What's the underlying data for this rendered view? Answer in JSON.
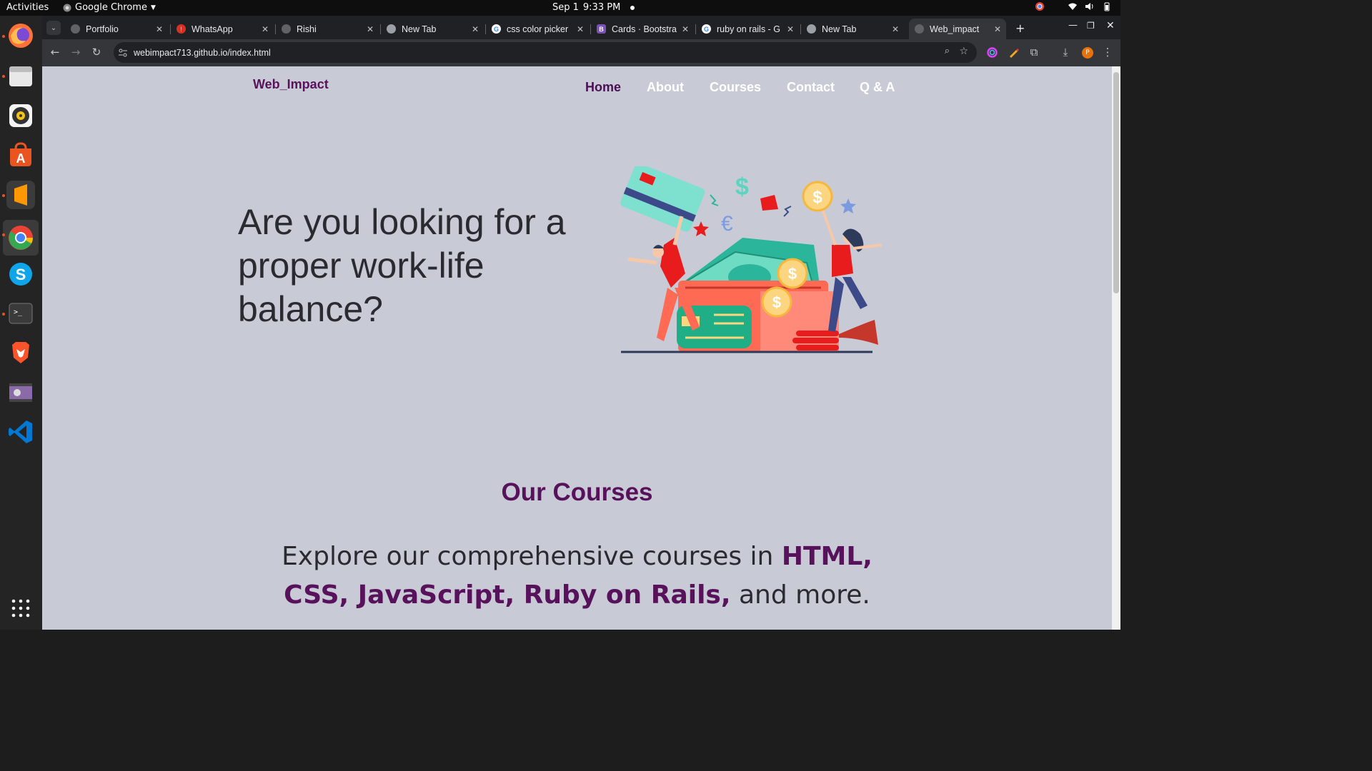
{
  "topbar": {
    "activities": "Activities",
    "app_name": "Google Chrome",
    "date": "Sep 1",
    "time": "9:33 PM"
  },
  "dock": {
    "apps": [
      "firefox-icon",
      "files-icon",
      "rhythmbox-icon",
      "app-center-icon",
      "sublime-text-icon",
      "chrome-icon",
      "skype-icon",
      "terminal-icon",
      "brave-icon",
      "video-icon",
      "vscode-icon",
      "app-grid-icon"
    ]
  },
  "browser": {
    "tabs": [
      {
        "title": "Portfolio",
        "favicon": "globe-icon"
      },
      {
        "title": "WhatsApp",
        "favicon": "whatsapp-icon"
      },
      {
        "title": "Rishi",
        "favicon": "globe-icon"
      },
      {
        "title": "New Tab",
        "favicon": "chrome-icon"
      },
      {
        "title": "css color picker",
        "favicon": "google-icon"
      },
      {
        "title": "Cards · Bootstra",
        "favicon": "bootstrap-icon"
      },
      {
        "title": "ruby on rails - G",
        "favicon": "google-icon"
      },
      {
        "title": "New Tab",
        "favicon": "chrome-icon"
      },
      {
        "title": "Web_impact",
        "favicon": "globe-icon",
        "active": true
      }
    ],
    "url": "webimpact713.github.io/index.html"
  },
  "site": {
    "brand": "Web_Impact",
    "nav": [
      {
        "label": "Home",
        "active": true
      },
      {
        "label": "About"
      },
      {
        "label": "Courses"
      },
      {
        "label": "Contact"
      },
      {
        "label": "Q & A"
      }
    ],
    "hero": {
      "headline": "Are you looking for a proper work-life balance?"
    },
    "courses": {
      "title": "Our Courses",
      "desc_prefix": "Explore our comprehensive courses in ",
      "desc_highlight": "HTML, CSS, JavaScript, Ruby on Rails,",
      "desc_suffix": " and more."
    }
  },
  "colors": {
    "page_bg": "#c8cbd6",
    "brand_purple": "#58115b",
    "nav_inactive": "#ffffff",
    "text_dark": "#2a2b30"
  }
}
